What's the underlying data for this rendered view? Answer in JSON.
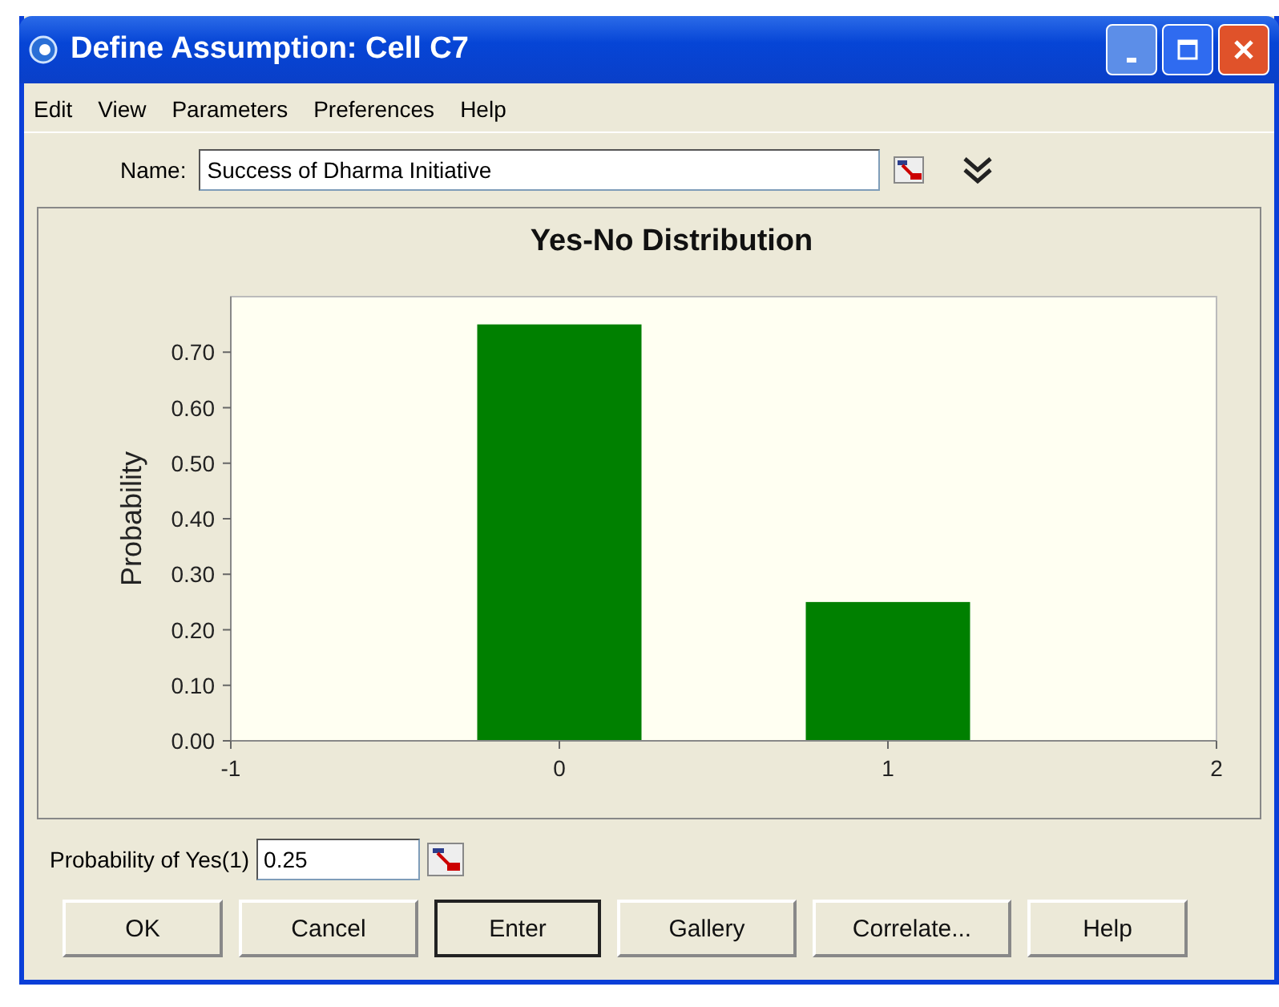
{
  "window": {
    "title": "Define Assumption: Cell C7"
  },
  "menu": [
    "Edit",
    "View",
    "Parameters",
    "Preferences",
    "Help"
  ],
  "name_field": {
    "label": "Name:",
    "value": "Success of Dharma Initiative"
  },
  "chart": {
    "chart_data": {
      "type": "bar",
      "title": "Yes-No Distribution",
      "ylabel": "Probability",
      "x": [
        0,
        1
      ],
      "series": [
        {
          "color": "#008000",
          "values": [
            0.75,
            0.25
          ]
        }
      ],
      "xlim": [
        -1,
        2
      ],
      "ylim": [
        0,
        0.8
      ],
      "xticks": [
        -1,
        0,
        1,
        2
      ],
      "yticks": [
        {
          "value": 0,
          "label": "0.00"
        },
        {
          "value": 0.1,
          "label": "0.10"
        },
        {
          "value": 0.2,
          "label": "0.20"
        },
        {
          "value": 0.3,
          "label": "0.30"
        },
        {
          "value": 0.4,
          "label": "0.40"
        },
        {
          "value": 0.5,
          "label": "0.50"
        },
        {
          "value": 0.6,
          "label": "0.60"
        },
        {
          "value": 0.7,
          "label": "0.70"
        }
      ]
    }
  },
  "parameter": {
    "label": "Probability of Yes(1)",
    "value": "0.25"
  },
  "buttons": [
    {
      "label": "OK",
      "default": false
    },
    {
      "label": "Cancel",
      "default": false
    },
    {
      "label": "Enter",
      "default": true
    },
    {
      "label": "Gallery",
      "default": false
    },
    {
      "label": "Correlate...",
      "default": false
    },
    {
      "label": "Help",
      "default": false
    }
  ]
}
